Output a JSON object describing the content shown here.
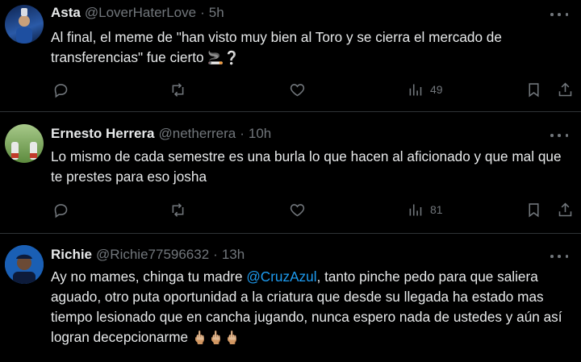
{
  "tweets": [
    {
      "name": "Asta",
      "handle": "@LoverHaterLove",
      "dot": "·",
      "time": "5h",
      "text": "Al final, el meme de \"han visto muy bien al Toro y se cierra el mercado de transferencias\" fue cierto",
      "emoji": "🚬❔",
      "views": "49"
    },
    {
      "name": "Ernesto Herrera",
      "handle": "@netherrera",
      "dot": "·",
      "time": "10h",
      "text": "Lo mismo de cada semestre es una burla lo que hacen al aficionado y que mal que te prestes para eso josha",
      "emoji": "",
      "views": "81"
    },
    {
      "name": "Richie",
      "handle": "@Richie77596632",
      "dot": "·",
      "time": "13h",
      "text_before": "Ay no mames, chinga tu madre ",
      "mention": "@CruzAzul",
      "text_after": ", tanto pinche pedo para que saliera aguado, otro puta oportunidad a la criatura que desde su llegada ha estado mas tiempo lesionado que en cancha jugando, nunca espero nada de ustedes y aún así logran decepcionarme",
      "emoji": "🖕🏼🖕🏼🖕🏼"
    }
  ],
  "icons": {
    "reply": "comment-icon",
    "retweet": "retweet-icon",
    "like": "heart-icon",
    "views": "views-icon",
    "bookmark": "bookmark-icon",
    "share": "share-icon",
    "more": "more-icon"
  },
  "colors": {
    "background": "#000000",
    "text": "#e7e9ea",
    "secondary": "#71767b",
    "link": "#1d9bf0",
    "divider": "#2f3336"
  }
}
